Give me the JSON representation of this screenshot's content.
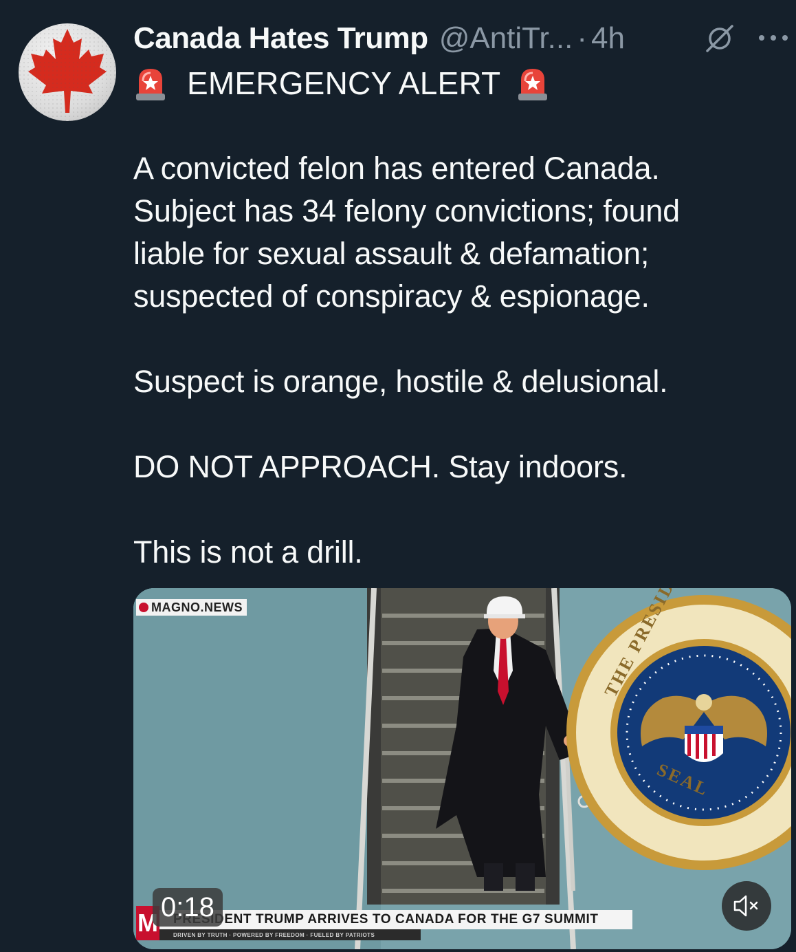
{
  "tweet": {
    "display_name": "Canada Hates Trump",
    "handle": "@AntiTr...",
    "separator": "·",
    "time": "4h",
    "alert_title": "EMERGENCY ALERT",
    "paragraphs": [
      [
        "A convicted felon has entered Canada.",
        "Subject has 34 felony convictions; found",
        "liable for sexual assault & defamation;",
        "suspected of conspiracy & espionage."
      ],
      [
        "Suspect is orange, hostile & delusional."
      ],
      [
        "DO NOT APPROACH. Stay indoors."
      ],
      [
        "This is not a drill."
      ]
    ]
  },
  "media": {
    "source_tag": "MAGNO.NEWS",
    "ticker": "PRESIDENT TRUMP ARRIVES TO CANADA FOR THE G7 SUMMIT",
    "ticker_sub": "DRIVEN BY TRUTH · POWERED BY FREEDOM · FUELED BY PATRIOTS",
    "m_logo": "M",
    "duration": "0:18",
    "seal_top": "PRESIDENT OF THE UNITED",
    "seal_bottom": "SEAL · STATES"
  },
  "icons": {
    "avatar": "canada-maple-leaf",
    "grok": "grok-icon",
    "more": "more-icon",
    "siren": "police-siren-emoji",
    "mute": "muted-speaker-icon"
  },
  "colors": {
    "background": "#15202b",
    "text": "#f7f9f9",
    "muted": "#8b98a5",
    "maple_red": "#d52b1e"
  }
}
